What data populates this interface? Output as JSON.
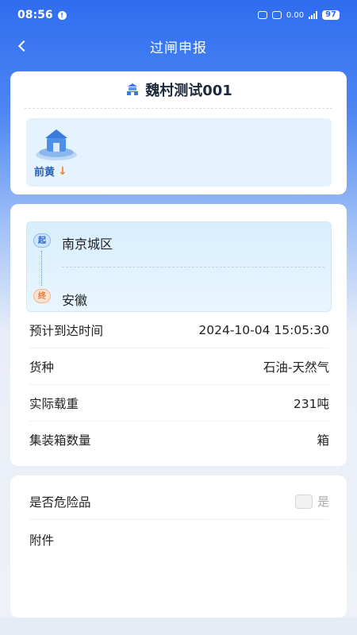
{
  "status": {
    "time": "08:56",
    "notif": "•",
    "net_speed": "0.00",
    "net_unit": "KB/s",
    "battery": "97"
  },
  "nav": {
    "title": "过闸申报"
  },
  "station": {
    "name": "魏村测试001"
  },
  "gate": {
    "label": "前黄",
    "direction_icon": "arrow-down-icon"
  },
  "route": {
    "start_tag": "起",
    "start": "南京城区",
    "end_tag": "终",
    "end": "安徽"
  },
  "details": [
    {
      "label": "预计到达时间",
      "value": "2024-10-04 15:05:30"
    },
    {
      "label": "货种",
      "value": "石油-天然气"
    },
    {
      "label": "实际载重",
      "value": "231吨"
    },
    {
      "label": "集装箱数量",
      "value": "箱"
    }
  ],
  "hazard": {
    "label": "是否危险品",
    "option": "是",
    "checked": false
  },
  "attachment": {
    "label": "附件"
  },
  "colors": {
    "primary": "#2f6df0",
    "accent": "#e28b3a"
  }
}
